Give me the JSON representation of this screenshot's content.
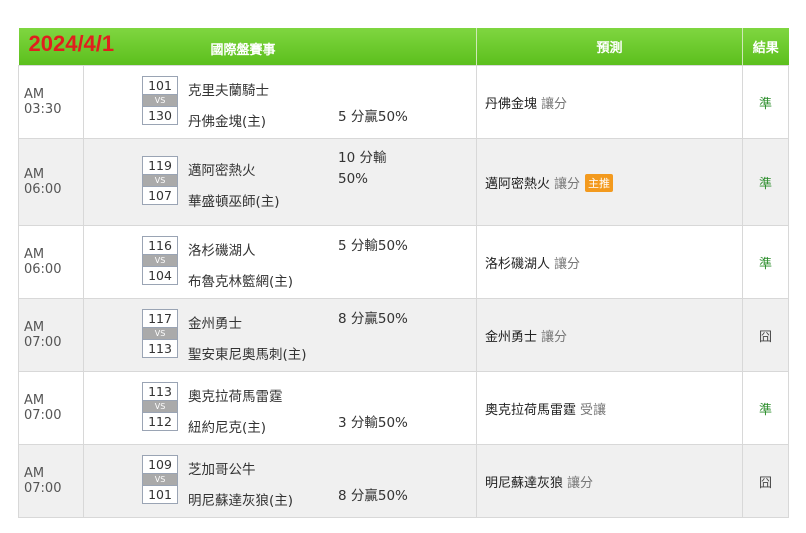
{
  "header": {
    "date": "2024/4/1",
    "main_title": "國際盤賽事",
    "prediction_title": "預測",
    "result_title": "結果"
  },
  "rows": [
    {
      "time": "AM 03:30",
      "away_num": "101",
      "away_team": "克里夫蘭騎士",
      "home_num": "130",
      "home_team": "丹佛金塊(主)",
      "vs": "VS",
      "handicap": "5 分贏50%",
      "handicap_pos": "home",
      "pick": "丹佛金塊",
      "pick_type": "讓分",
      "badge": "",
      "result": "準",
      "result_kind": "win"
    },
    {
      "time": "AM 06:00",
      "away_num": "119",
      "away_team": "邁阿密熱火",
      "home_num": "107",
      "home_team": "華盛頓巫師(主)",
      "vs": "VS",
      "handicap": "10 分輸 50%",
      "handicap_pos": "away",
      "pick": "邁阿密熱火",
      "pick_type": "讓分",
      "badge": "主推",
      "result": "準",
      "result_kind": "win"
    },
    {
      "time": "AM 06:00",
      "away_num": "116",
      "away_team": "洛杉磯湖人",
      "home_num": "104",
      "home_team": "布魯克林籃網(主)",
      "vs": "VS",
      "handicap": "5 分輸50%",
      "handicap_pos": "away",
      "pick": "洛杉磯湖人",
      "pick_type": "讓分",
      "badge": "",
      "result": "準",
      "result_kind": "win"
    },
    {
      "time": "AM 07:00",
      "away_num": "117",
      "away_team": "金州勇士",
      "home_num": "113",
      "home_team": "聖安東尼奧馬刺(主)",
      "vs": "VS",
      "handicap": "8 分贏50%",
      "handicap_pos": "away",
      "pick": "金州勇士",
      "pick_type": "讓分",
      "badge": "",
      "result": "囧",
      "result_kind": "lose"
    },
    {
      "time": "AM 07:00",
      "away_num": "113",
      "away_team": "奧克拉荷馬雷霆",
      "home_num": "112",
      "home_team": "紐約尼克(主)",
      "vs": "VS",
      "handicap": "3 分輸50%",
      "handicap_pos": "home",
      "pick": "奧克拉荷馬雷霆",
      "pick_type": "受讓",
      "badge": "",
      "result": "準",
      "result_kind": "win"
    },
    {
      "time": "AM 07:00",
      "away_num": "109",
      "away_team": "芝加哥公牛",
      "home_num": "101",
      "home_team": "明尼蘇達灰狼(主)",
      "vs": "VS",
      "handicap": "8 分贏50%",
      "handicap_pos": "home",
      "pick": "明尼蘇達灰狼",
      "pick_type": "讓分",
      "badge": "",
      "result": "囧",
      "result_kind": "lose"
    }
  ],
  "colors": {
    "header_green": "#5cbf1d",
    "date_red": "#e0201e",
    "badge_orange": "#f39a1e",
    "win_green": "#2e8f2e"
  }
}
